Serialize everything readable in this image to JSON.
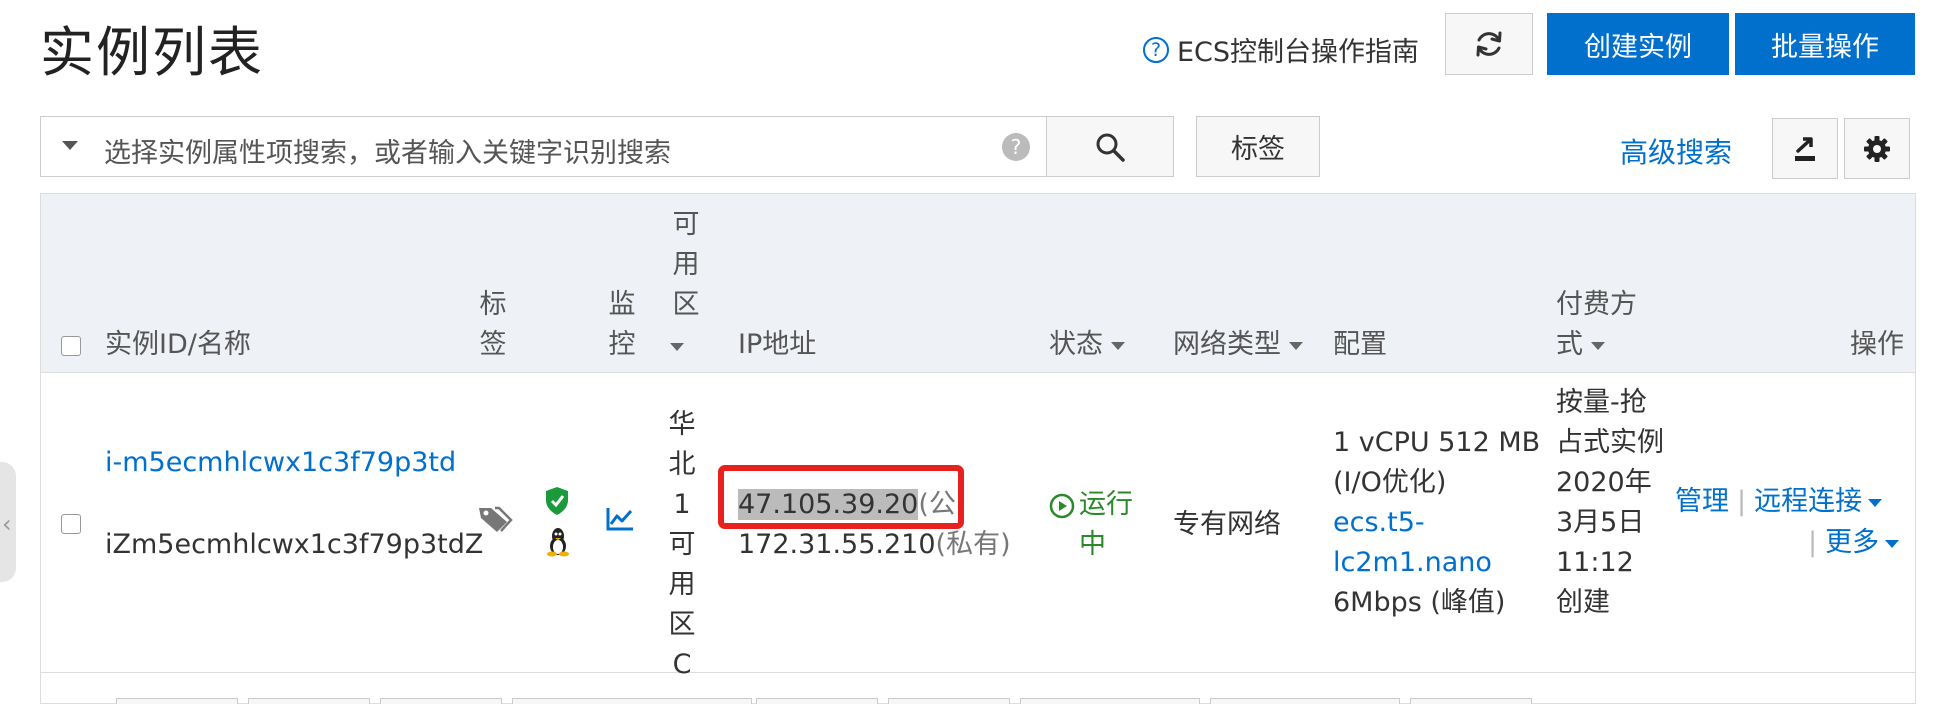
{
  "header": {
    "title": "实例列表",
    "guide_icon": "?",
    "guide_link": "ECS控制台操作指南",
    "create_button": "创建实例",
    "batch_button": "批量操作"
  },
  "search": {
    "placeholder": "选择实例属性项搜索，或者输入关键字识别搜索",
    "help_icon": "?",
    "tag_button": "标签",
    "advanced_search": "高级搜索"
  },
  "table": {
    "columns": {
      "instance": "实例ID/名称",
      "tag": "标签",
      "monitor": "监控",
      "zone": "可用区",
      "ip": "IP地址",
      "status": "状态",
      "network": "网络类型",
      "config": "配置",
      "billing": "付费方式",
      "actions": "操作"
    },
    "rows": [
      {
        "instance_id": "i-m5ecmhlcwx1c3f79p3td",
        "instance_name": "iZm5ecmhlcwx1c3f79p3tdZ",
        "zone": "华北 1 可用区 C",
        "public_ip": "47.105.39.20",
        "public_suffix": "(公)",
        "private_ip": "172.31.55.210",
        "private_suffix": "(私有)",
        "status": "运行中",
        "network": "专有网络",
        "config_spec": "1 vCPU 512 MB (I/O优化)",
        "config_type": "ecs.t5-lc2m1.nano",
        "config_bandwidth": "6Mbps (峰值)",
        "billing": "按量-抢占式实例 2020年3月5日 11:12 创建",
        "action_manage": "管理",
        "action_remote": "远程连接",
        "action_more": "更多"
      }
    ]
  },
  "colors": {
    "primary": "#0070cc",
    "highlight": "#e8201e",
    "running": "#2a8a2a",
    "header_bg": "#eef1f5"
  },
  "icons": [
    "refresh-icon",
    "search-icon",
    "export-icon",
    "gear-icon",
    "tag-icon",
    "security-shield-icon",
    "linux-icon",
    "monitor-chart-icon",
    "running-play-icon",
    "chevron-left-icon"
  ]
}
